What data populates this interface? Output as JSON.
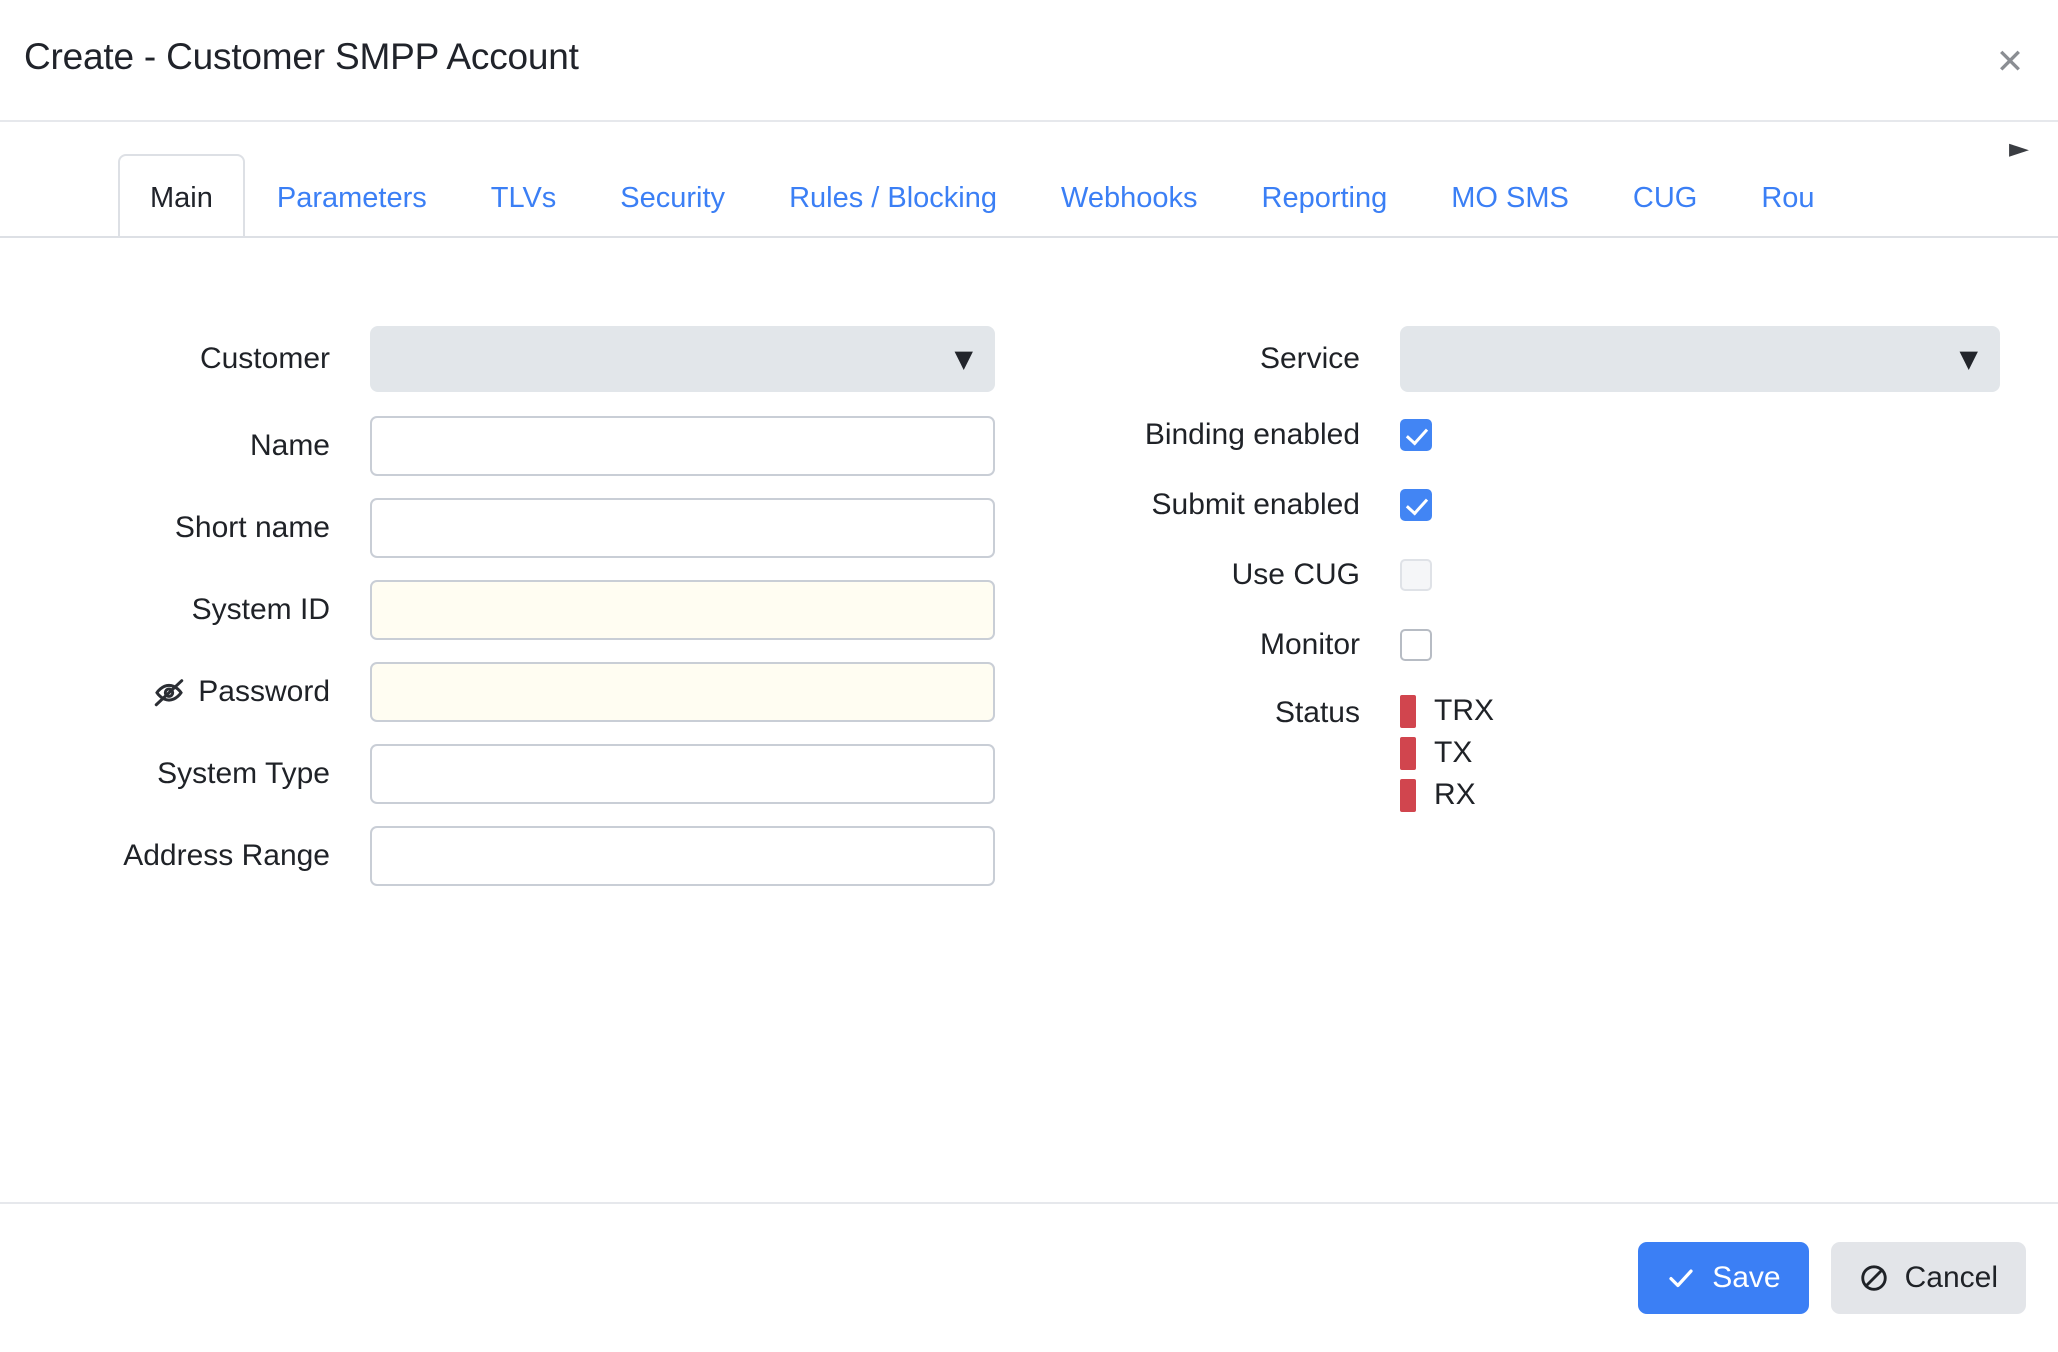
{
  "dialog": {
    "title": "Create - Customer SMPP Account",
    "close_icon": "close-icon"
  },
  "tabs": {
    "items": [
      {
        "label": "Main",
        "active": true
      },
      {
        "label": "Parameters",
        "active": false
      },
      {
        "label": "TLVs",
        "active": false
      },
      {
        "label": "Security",
        "active": false
      },
      {
        "label": "Rules / Blocking",
        "active": false
      },
      {
        "label": "Webhooks",
        "active": false
      },
      {
        "label": "Reporting",
        "active": false
      },
      {
        "label": "MO SMS",
        "active": false
      },
      {
        "label": "CUG",
        "active": false
      },
      {
        "label": "Rou",
        "active": false
      }
    ],
    "scroll_right_icon": "►"
  },
  "form": {
    "customer": {
      "label": "Customer",
      "value": "",
      "caret": "▼"
    },
    "name": {
      "label": "Name",
      "value": "",
      "placeholder": ""
    },
    "short_name": {
      "label": "Short name",
      "value": "",
      "placeholder": ""
    },
    "system_id": {
      "label": "System ID",
      "value": "",
      "placeholder": ""
    },
    "password": {
      "label": "Password",
      "value": "",
      "placeholder": "",
      "icon": "eye-off-icon"
    },
    "system_type": {
      "label": "System Type",
      "value": "",
      "placeholder": ""
    },
    "address_range": {
      "label": "Address Range",
      "value": "",
      "placeholder": ""
    },
    "service": {
      "label": "Service",
      "value": "",
      "caret": "▼"
    },
    "binding_enabled": {
      "label": "Binding enabled",
      "checked": true
    },
    "submit_enabled": {
      "label": "Submit enabled",
      "checked": true
    },
    "use_cug": {
      "label": "Use CUG",
      "checked": false,
      "disabled": true
    },
    "monitor": {
      "label": "Monitor",
      "checked": false,
      "disabled": false
    },
    "status": {
      "label": "Status",
      "items": [
        {
          "text": "TRX",
          "color": "#d1454e"
        },
        {
          "text": "TX",
          "color": "#d1454e"
        },
        {
          "text": "RX",
          "color": "#d1454e"
        }
      ]
    }
  },
  "footer": {
    "save_label": "Save",
    "cancel_label": "Cancel"
  },
  "colors": {
    "accent": "#3b7ff5",
    "tab_link": "#3b7ff5",
    "checkbox_checked": "#4285f4",
    "status_red": "#d1454e",
    "select_bg": "#e2e6ea",
    "cancel_bg": "#e3e5e9"
  }
}
